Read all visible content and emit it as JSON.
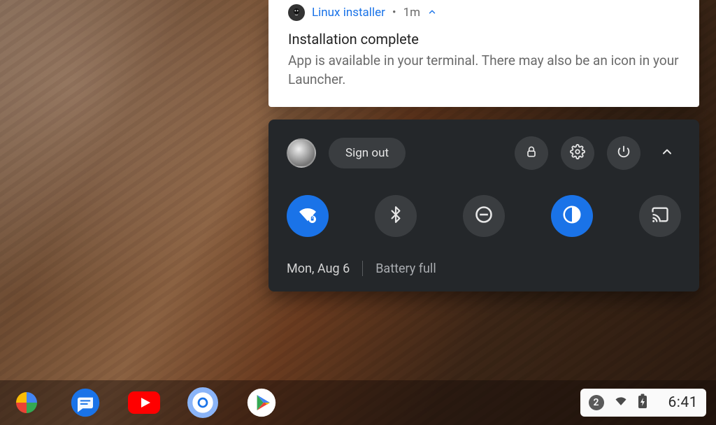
{
  "notification": {
    "app_name": "Linux installer",
    "time": "1m",
    "title": "Installation complete",
    "body": "App is available in your terminal. There may also be an icon in your Launcher."
  },
  "quicksettings": {
    "sign_out_label": "Sign out",
    "date": "Mon, Aug 6",
    "battery_status": "Battery full",
    "toggles": {
      "wifi_active": true,
      "nightlight_active": true
    }
  },
  "shelf": {
    "notification_count": "2",
    "clock": "6:41"
  },
  "colors": {
    "accent": "#1a73e8",
    "panel": "#24272a",
    "panel_surface": "#3a3d40"
  }
}
